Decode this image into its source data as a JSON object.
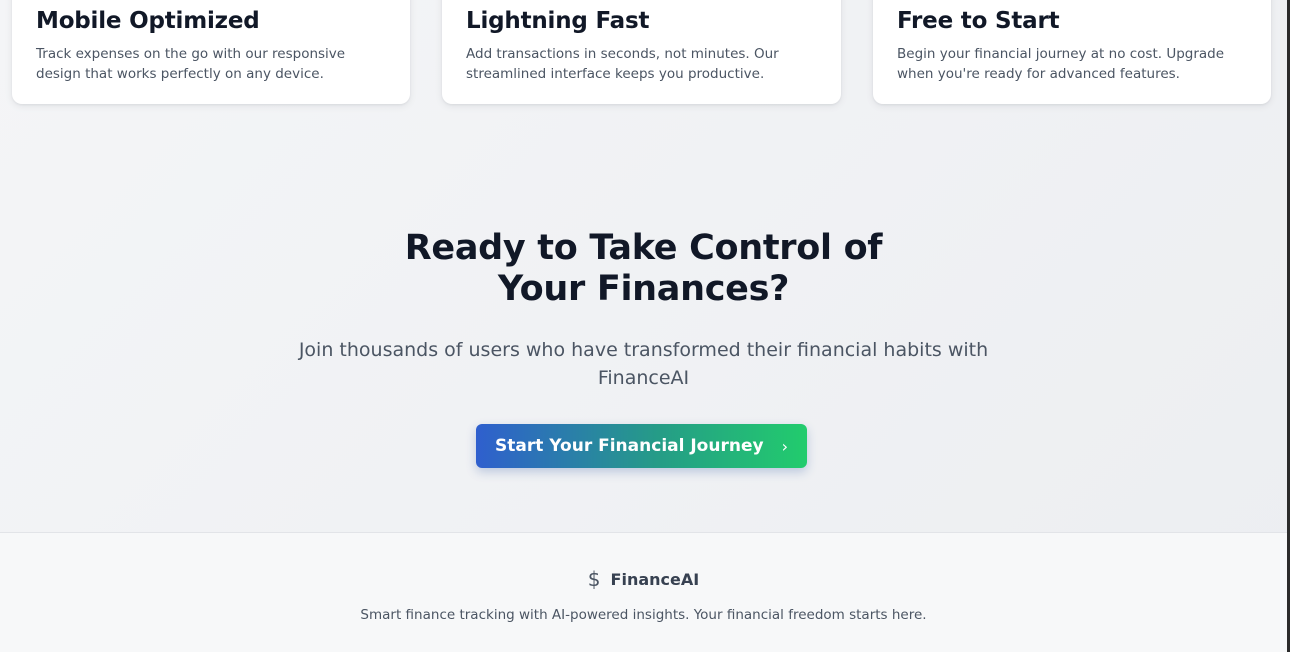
{
  "features": [
    {
      "title": "Mobile Optimized",
      "description": "Track expenses on the go with our responsive design that works perfectly on any device."
    },
    {
      "title": "Lightning Fast",
      "description": "Add transactions in seconds, not minutes. Our streamlined interface keeps you productive."
    },
    {
      "title": "Free to Start",
      "description": "Begin your financial journey at no cost. Upgrade when you're ready for advanced features."
    }
  ],
  "cta": {
    "heading": "Ready to Take Control of Your Finances?",
    "subheading": "Join thousands of users who have transformed their financial habits with FinanceAI",
    "button_label": "Start Your Financial Journey",
    "button_icon": "chevron-right-icon",
    "button_gradient": [
      "#2f5fce",
      "#22cc6d"
    ]
  },
  "footer": {
    "brand_icon": "dollar-icon",
    "brand_name": "FinanceAI",
    "tagline": "Smart finance tracking with AI-powered insights. Your financial freedom starts here."
  }
}
